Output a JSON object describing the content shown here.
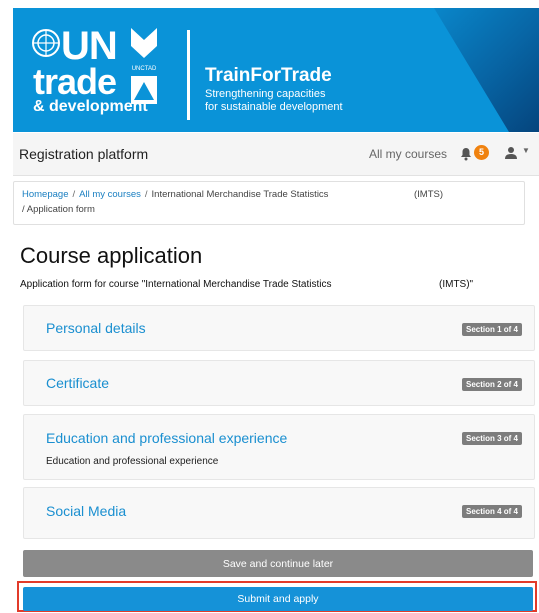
{
  "banner": {
    "logo_un": "UN",
    "logo_trade": "trade",
    "logo_dev": "& development",
    "unctad_label": "UNCTAD",
    "title": "TrainForTrade",
    "subtitle_line1": "Strengthening capacities",
    "subtitle_line2": "for sustainable development",
    "colors": {
      "background": "#0a93d8"
    }
  },
  "navbar": {
    "brand": "Registration platform",
    "my_courses": "All my courses",
    "notification_count": "5"
  },
  "breadcrumb": {
    "home": "Homepage",
    "courses": "All my courses",
    "sep": "/",
    "course": "International Merchandise Trade Statistics",
    "course_suffix": "(IMTS)",
    "current": "Application form"
  },
  "page": {
    "title": "Course application",
    "intro": "Application form for course \"International Merchandise Trade Statistics",
    "intro_suffix": "(IMTS)\""
  },
  "sections": [
    {
      "title": "Personal details",
      "badge": "Section 1 of 4",
      "description": ""
    },
    {
      "title": "Certificate",
      "badge": "Section 2 of 4",
      "description": ""
    },
    {
      "title": "Education and professional experience",
      "badge": "Section 3 of 4",
      "description": "Education and professional experience"
    },
    {
      "title": "Social Media",
      "badge": "Section 4 of 4",
      "description": ""
    }
  ],
  "actions": {
    "save_later": "Save and continue later",
    "submit": "Submit and apply"
  },
  "colors": {
    "accent": "#1592d8",
    "highlight": "#e23b2a",
    "badge": "#f0820f"
  }
}
